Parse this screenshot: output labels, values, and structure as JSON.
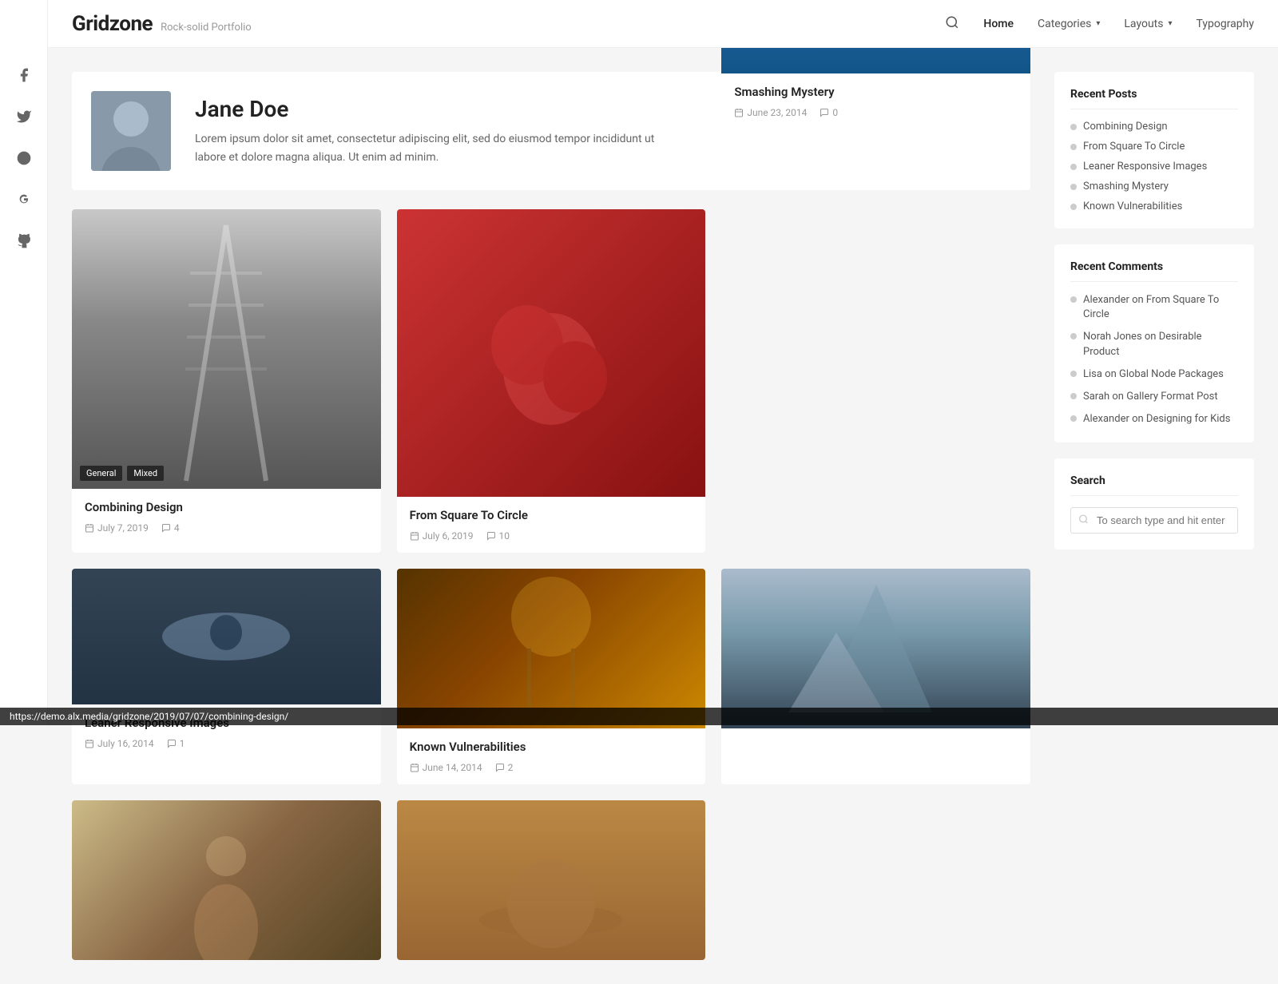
{
  "brand": {
    "name": "Gridzone",
    "tagline": "Rock-solid Portfolio"
  },
  "nav": {
    "search_label": "search",
    "links": [
      {
        "label": "Home",
        "active": true,
        "has_dropdown": false
      },
      {
        "label": "Categories",
        "active": false,
        "has_dropdown": true
      },
      {
        "label": "Layouts",
        "active": false,
        "has_dropdown": true
      },
      {
        "label": "Typography",
        "active": false,
        "has_dropdown": false
      }
    ]
  },
  "social_icons": [
    {
      "name": "facebook-icon",
      "symbol": "f"
    },
    {
      "name": "twitter-icon",
      "symbol": "t"
    },
    {
      "name": "dribbble-icon",
      "symbol": "d"
    },
    {
      "name": "google-icon",
      "symbol": "g"
    },
    {
      "name": "github-icon",
      "symbol": "gh"
    }
  ],
  "author": {
    "name": "Jane Doe",
    "bio": "Lorem ipsum dolor sit amet, consectetur adipiscing elit, sed do eiusmod tempor incididunt ut labore et dolore magna aliqua. Ut enim ad minim."
  },
  "posts": [
    {
      "id": 1,
      "title": "Combining Design",
      "date": "July 7, 2019",
      "comments": "4",
      "image_class": "img-railway",
      "tags": [
        "General",
        "Mixed"
      ],
      "has_tags": true,
      "col_span": 1,
      "row": 1
    },
    {
      "id": 2,
      "title": "From Square To Circle",
      "date": "July 6, 2019",
      "comments": "10",
      "image_class": "img-strawberry",
      "tags": [],
      "has_tags": false,
      "col_span": 1,
      "row": 1
    },
    {
      "id": 3,
      "title": "Leaner Responsive Images",
      "date": "July 16, 2014",
      "comments": "1",
      "image_class": "img-eyes",
      "tags": [],
      "has_tags": false,
      "col_span": 1,
      "row": 1
    },
    {
      "id": 4,
      "title": "Known Vulnerabilities",
      "date": "June 14, 2014",
      "comments": "2",
      "image_class": "img-concert",
      "tags": [],
      "has_tags": false,
      "col_span": 1,
      "row": 2
    },
    {
      "id": 5,
      "title": "Smashing Mystery",
      "date": "June 23, 2014",
      "comments": "0",
      "image_class": "img-lake",
      "tags": [],
      "has_tags": false,
      "col_span": 1,
      "row": 1
    }
  ],
  "sidebar": {
    "recent_posts_title": "Recent Posts",
    "recent_posts": [
      {
        "label": "Combining Design"
      },
      {
        "label": "From Square To Circle"
      },
      {
        "label": "Leaner Responsive Images"
      },
      {
        "label": "Smashing Mystery"
      },
      {
        "label": "Known Vulnerabilities"
      }
    ],
    "recent_comments_title": "Recent Comments",
    "recent_comments": [
      {
        "text": "Alexander on From Square To Circle"
      },
      {
        "text": "Norah Jones on Desirable Product"
      },
      {
        "text": "Lisa on Global Node Packages"
      },
      {
        "text": "Sarah on Gallery Format Post"
      },
      {
        "text": "Alexander on Designing for Kids"
      }
    ],
    "search_title": "Search",
    "search_placeholder": "To search type and hit enter"
  },
  "status_bar": {
    "url": "https://demo.alx.media/gridzone/2019/07/07/combining-design/"
  }
}
